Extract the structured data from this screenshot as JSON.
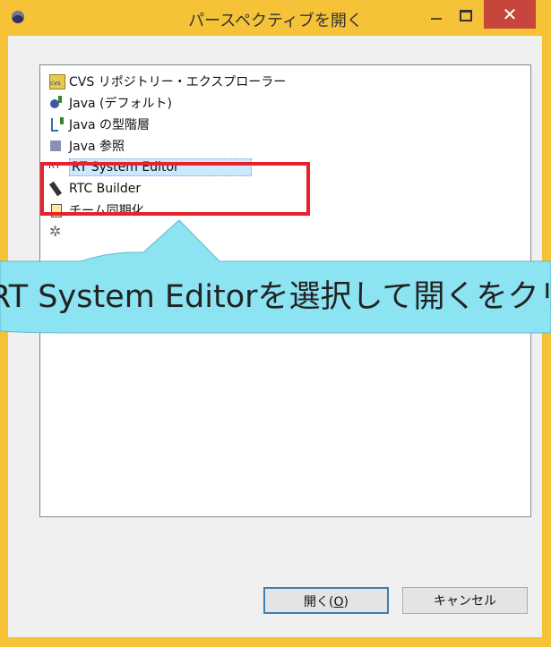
{
  "window": {
    "title": "パースペクティブを開く",
    "close_glyph": "✕"
  },
  "list": {
    "items": [
      {
        "label": "CVS リポジトリー・エクスプローラー",
        "icon": "cvs-repository-icon"
      },
      {
        "label": "Java (デフォルト)",
        "icon": "java-perspective-icon"
      },
      {
        "label": "Java の型階層",
        "icon": "type-hierarchy-icon"
      },
      {
        "label": "Java 参照",
        "icon": "java-browsing-icon"
      },
      {
        "label": "RT System Editor",
        "icon": "rt-icon",
        "selected": true
      },
      {
        "label": "RTC Builder",
        "icon": "rtc-builder-icon"
      },
      {
        "label": "チーム同期化",
        "icon": "team-sync-icon"
      },
      {
        "label": "",
        "icon": "other-perspective-icon"
      }
    ]
  },
  "annotation": {
    "text": "RT System Editorを選択して開くをクリック"
  },
  "buttons": {
    "open_label": "開く(",
    "open_mnemonic": "O",
    "open_suffix": ")",
    "cancel_label": "キャンセル"
  },
  "colors": {
    "frame": "#f5c238",
    "close": "#c6463b",
    "highlight": "#e8212b",
    "callout": "#8ce3f2",
    "selection": "#cce8ff"
  }
}
